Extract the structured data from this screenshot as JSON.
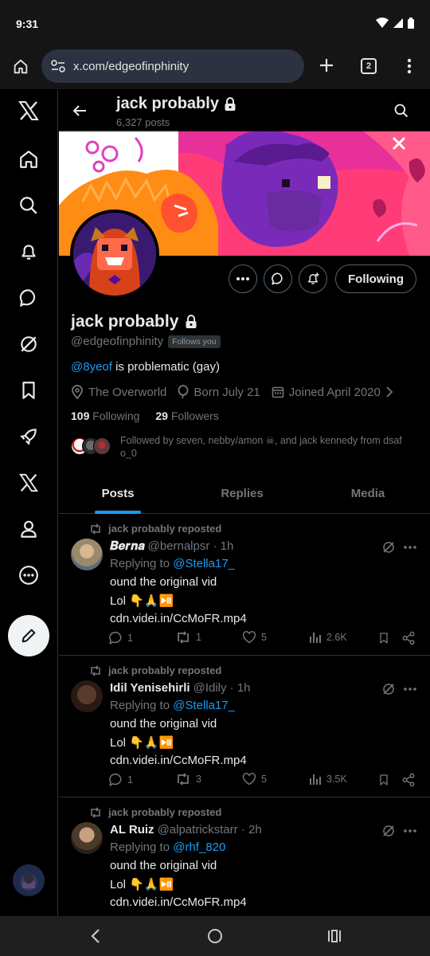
{
  "status": {
    "time": "9:31"
  },
  "browser": {
    "url": "x.com/edgeofinphinity",
    "tab_count": "2"
  },
  "profile": {
    "top_name": "jack probably",
    "posts_count": "6,327 posts",
    "display_name": "jack probably",
    "handle": "@edgeofinphinity",
    "follows_you": "Follows you",
    "bio_mention": "@8yeof",
    "bio_rest": " is problematic (gay)",
    "location": "The Overworld",
    "born": "Born July 21",
    "joined": "Joined April 2020",
    "following_count": "109",
    "following_label": "Following",
    "followers_count": "29",
    "followers_label": "Followers",
    "followed_by": "Followed by seven, nebby/amon ☠, and jack kennedy from dsaf o_0",
    "following_button": "Following"
  },
  "tabs": [
    "Posts",
    "Replies",
    "Media"
  ],
  "posts": [
    {
      "repost_label": "jack probably reposted",
      "name": "𝑩𝒆𝒓𝒏𝒂",
      "handle_time": "@bernalpsr · 1h",
      "reply_prefix": "Replying to ",
      "reply_to": "@Stella17_",
      "line1": "ound the original vid",
      "line2": "Lol 👇🙏⏯️",
      "link": "cdn.videi.in/CcMoFR.mp4",
      "replies": "1",
      "reposts": "1",
      "likes": "5",
      "views": "2.6K"
    },
    {
      "repost_label": "jack probably reposted",
      "name": "Idil Yenisehirli",
      "handle_time": "@Idily · 1h",
      "reply_prefix": "Replying to ",
      "reply_to": "@Stella17_",
      "line1": "ound the original vid",
      "line2": "Lol 👇🙏⏯️",
      "link": "cdn.videi.in/CcMoFR.mp4",
      "replies": "1",
      "reposts": "3",
      "likes": "5",
      "views": "3.5K"
    },
    {
      "repost_label": "jack probably reposted",
      "name": "AL Ruiz",
      "handle_time": "@alpatrickstarr · 2h",
      "reply_prefix": "Replying to ",
      "reply_to": "@rhf_820",
      "line1": "ound the original vid",
      "line2": "Lol 👇🙏⏯️",
      "link": "cdn.videi.in/CcMoFR.mp4"
    }
  ],
  "colors": {
    "accent": "#1d9bf0",
    "muted": "#71767b",
    "text": "#e7e9ea",
    "border": "#2f3336"
  }
}
